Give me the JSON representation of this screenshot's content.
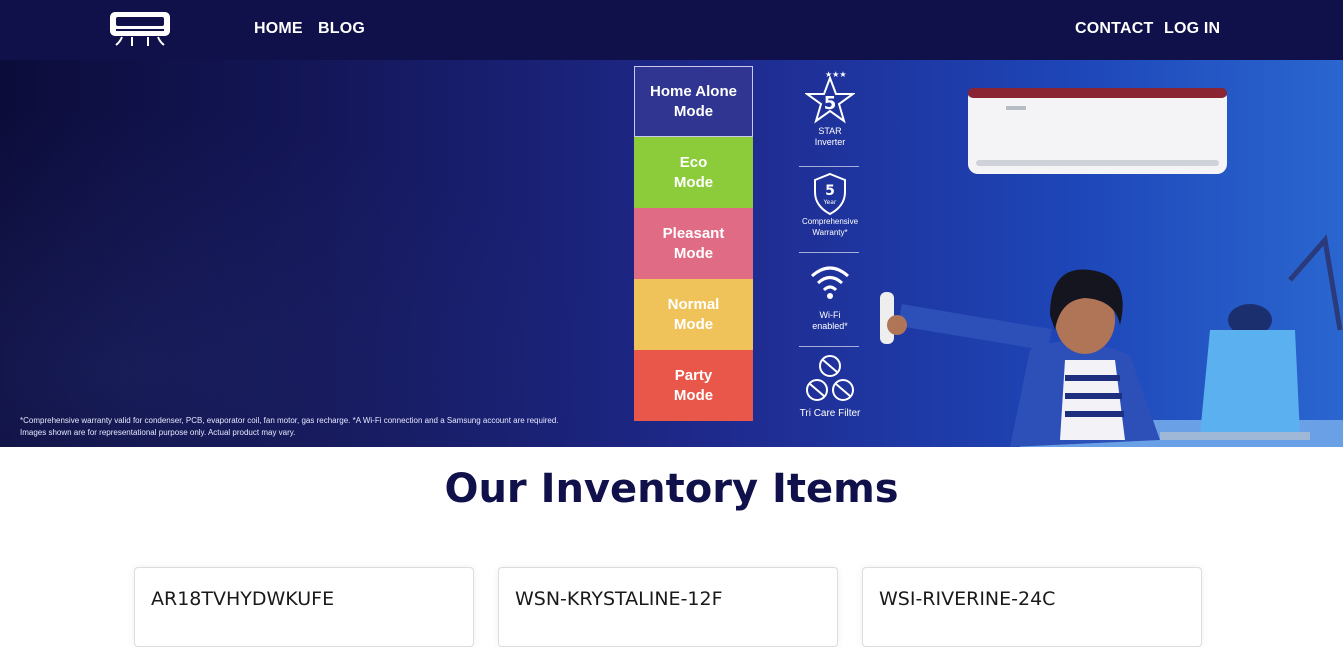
{
  "nav": {
    "logo_icon": "air-conditioner-icon",
    "home": "HOME",
    "blog": "BLOG",
    "contact": "CONTACT",
    "login": "LOG IN"
  },
  "hero": {
    "disclaimer_line1": "*Comprehensive warranty valid for condenser, PCB, evaporator coil, fan motor, gas recharge. *A Wi-Fi connection and a Samsung account are required.",
    "disclaimer_line2": "Images shown are for representational purpose only. Actual product may vary.",
    "modes": [
      {
        "line1": "Home Alone",
        "line2": "Mode",
        "color": "#2f3590"
      },
      {
        "line1": "Eco",
        "line2": "Mode",
        "color": "#8ccc3a"
      },
      {
        "line1": "Pleasant",
        "line2": "Mode",
        "color": "#e06b85"
      },
      {
        "line1": "Normal",
        "line2": "Mode",
        "color": "#f0c25a"
      },
      {
        "line1": "Party",
        "line2": "Mode",
        "color": "#e8574a"
      }
    ],
    "features": {
      "star_number": "5",
      "star_line1": "STAR",
      "star_line2": "Inverter",
      "warranty_number": "5",
      "warranty_unit": "Year",
      "warranty_line1": "Comprehensive",
      "warranty_line2": "Warranty*",
      "wifi_line1": "Wi-Fi",
      "wifi_line2": "enabled*",
      "filter_label": "Tri Care Filter"
    }
  },
  "inventory": {
    "title": "Our Inventory Items",
    "items": [
      {
        "name": "AR18TVHYDWKUFE"
      },
      {
        "name": "WSN-KRYSTALINE-12F"
      },
      {
        "name": "WSI-RIVERINE-24C"
      }
    ]
  },
  "colors": {
    "navbar_bg": "#10104a",
    "title_color": "#10104a"
  }
}
